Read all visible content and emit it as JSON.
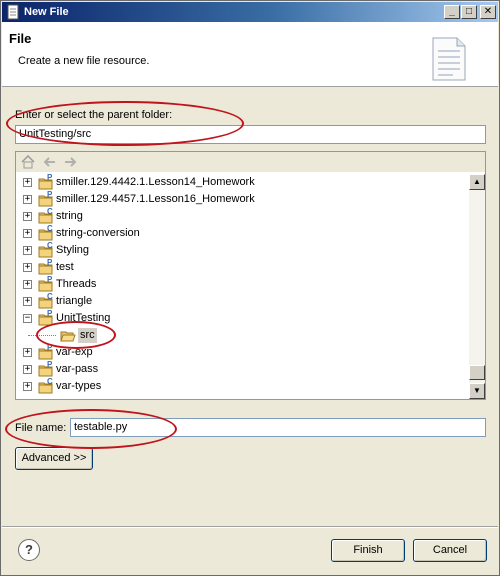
{
  "window": {
    "title": "New File",
    "minimize_glyph": "_",
    "maximize_glyph": "□",
    "close_glyph": "✕"
  },
  "header": {
    "title": "File",
    "description": "Create a new file resource."
  },
  "parent_folder": {
    "label": "Enter or select the parent folder:",
    "value": "UnitTesting/src"
  },
  "tree": {
    "toolbar": {
      "home": "home-icon",
      "back": "back-arrow-icon",
      "forward": "forward-arrow-icon"
    },
    "items": [
      {
        "label": "smiller.129.4442.1.Lesson14_Homework",
        "expander": "+",
        "icon_badge": "P"
      },
      {
        "label": "smiller.129.4457.1.Lesson16_Homework",
        "expander": "+",
        "icon_badge": "P"
      },
      {
        "label": "string",
        "expander": "+",
        "icon_badge": "C"
      },
      {
        "label": "string-conversion",
        "expander": "+",
        "icon_badge": "C"
      },
      {
        "label": "Styling",
        "expander": "+",
        "icon_badge": "C"
      },
      {
        "label": "test",
        "expander": "+",
        "icon_badge": "P"
      },
      {
        "label": "Threads",
        "expander": "+",
        "icon_badge": "P"
      },
      {
        "label": "triangle",
        "expander": "+",
        "icon_badge": "C"
      },
      {
        "label": "UnitTesting",
        "expander": "−",
        "icon_badge": "P"
      },
      {
        "label": "src",
        "expander": "",
        "icon_badge": "",
        "selected": true
      },
      {
        "label": "var-exp",
        "expander": "+",
        "icon_badge": "P"
      },
      {
        "label": "var-pass",
        "expander": "+",
        "icon_badge": "P"
      },
      {
        "label": "var-types",
        "expander": "+",
        "icon_badge": "C"
      }
    ]
  },
  "file_name": {
    "label": "File name:",
    "value": "testable.py"
  },
  "buttons": {
    "advanced": "Advanced >>",
    "finish": "Finish",
    "cancel": "Cancel",
    "help": "?"
  },
  "colors": {
    "annotation_oval": "#c0131b",
    "title_bar": "#0a246a"
  }
}
